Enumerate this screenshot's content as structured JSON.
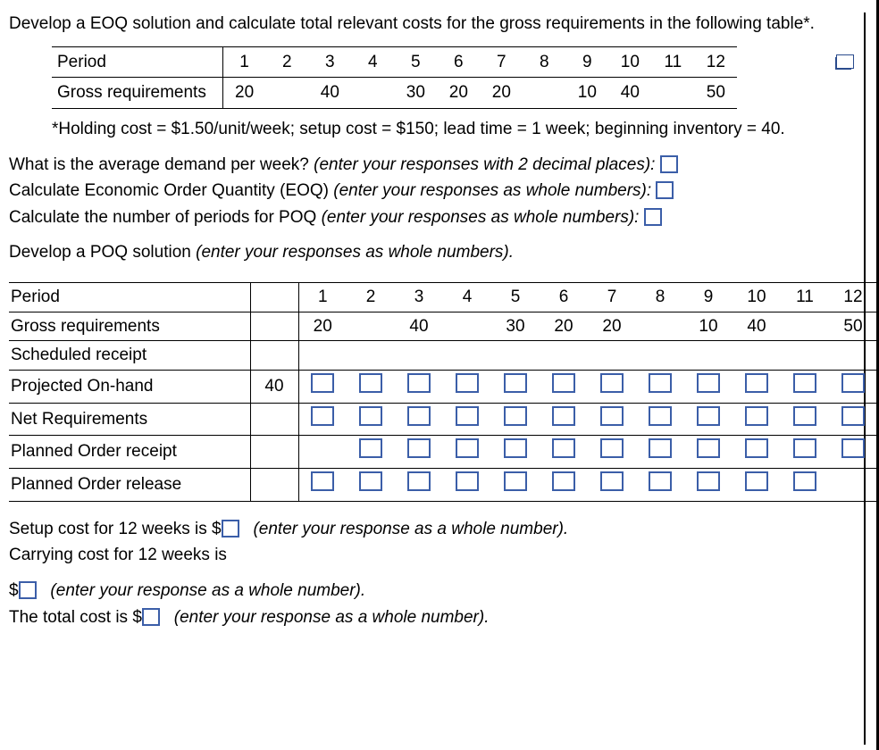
{
  "intro": "Develop a EOQ solution and calculate total relevant costs for the gross requirements in the following table*.",
  "top_table": {
    "row1_label": "Period",
    "row2_label": "Gross requirements",
    "periods": [
      "1",
      "2",
      "3",
      "4",
      "5",
      "6",
      "7",
      "8",
      "9",
      "10",
      "11",
      "12"
    ],
    "gross": [
      "20",
      "",
      "40",
      "",
      "30",
      "20",
      "20",
      "",
      "10",
      "40",
      "",
      "50"
    ]
  },
  "footnote": "*Holding cost = $1.50/unit/week; setup cost = $150; lead time = 1 week; beginning inventory = 40.",
  "q1": {
    "text": "What is the average demand per week? ",
    "hint": "(enter your responses with 2 decimal places):"
  },
  "q2": {
    "text": "Calculate Economic Order Quantity (EOQ) ",
    "hint": "(enter your responses as whole numbers):"
  },
  "q3": {
    "text": "Calculate the number of periods for POQ  ",
    "hint": "(enter your responses as whole numbers):"
  },
  "poq_hdr": {
    "text": "Develop a POQ solution ",
    "hint": "(enter your responses as whole numbers)."
  },
  "wtable": {
    "period_label": "Period",
    "periods": [
      "1",
      "2",
      "3",
      "4",
      "5",
      "6",
      "7",
      "8",
      "9",
      "10",
      "11",
      "12"
    ],
    "gross_label": "Gross requirements",
    "gross": [
      "20",
      "",
      "40",
      "",
      "30",
      "20",
      "20",
      "",
      "10",
      "40",
      "",
      "50"
    ],
    "sched_label": "Scheduled receipt",
    "proj_label": "Projected On-hand",
    "proj_begin": "40",
    "net_label": "Net Requirements",
    "por_label": "Planned Order receipt",
    "porel_label": "Planned Order release",
    "proj_boxes": [
      1,
      1,
      1,
      1,
      1,
      1,
      1,
      1,
      1,
      1,
      1,
      1
    ],
    "net_boxes": [
      1,
      1,
      1,
      1,
      1,
      1,
      1,
      1,
      1,
      1,
      1,
      1
    ],
    "por_boxes": [
      0,
      1,
      1,
      1,
      1,
      1,
      1,
      1,
      1,
      1,
      1,
      1
    ],
    "porel_boxes": [
      1,
      1,
      1,
      1,
      1,
      1,
      1,
      1,
      1,
      1,
      1,
      0
    ]
  },
  "setup_line": {
    "pre": "Setup cost for 12 weeks is $",
    "post": "(enter your response as a whole number)."
  },
  "carry_line": "Carrying cost  for 12 weeks is",
  "carry2": {
    "pre": "$",
    "post": "(enter your response as a whole number)."
  },
  "total": {
    "pre": "The total cost is $",
    "post": "(enter your response as a whole number)."
  }
}
